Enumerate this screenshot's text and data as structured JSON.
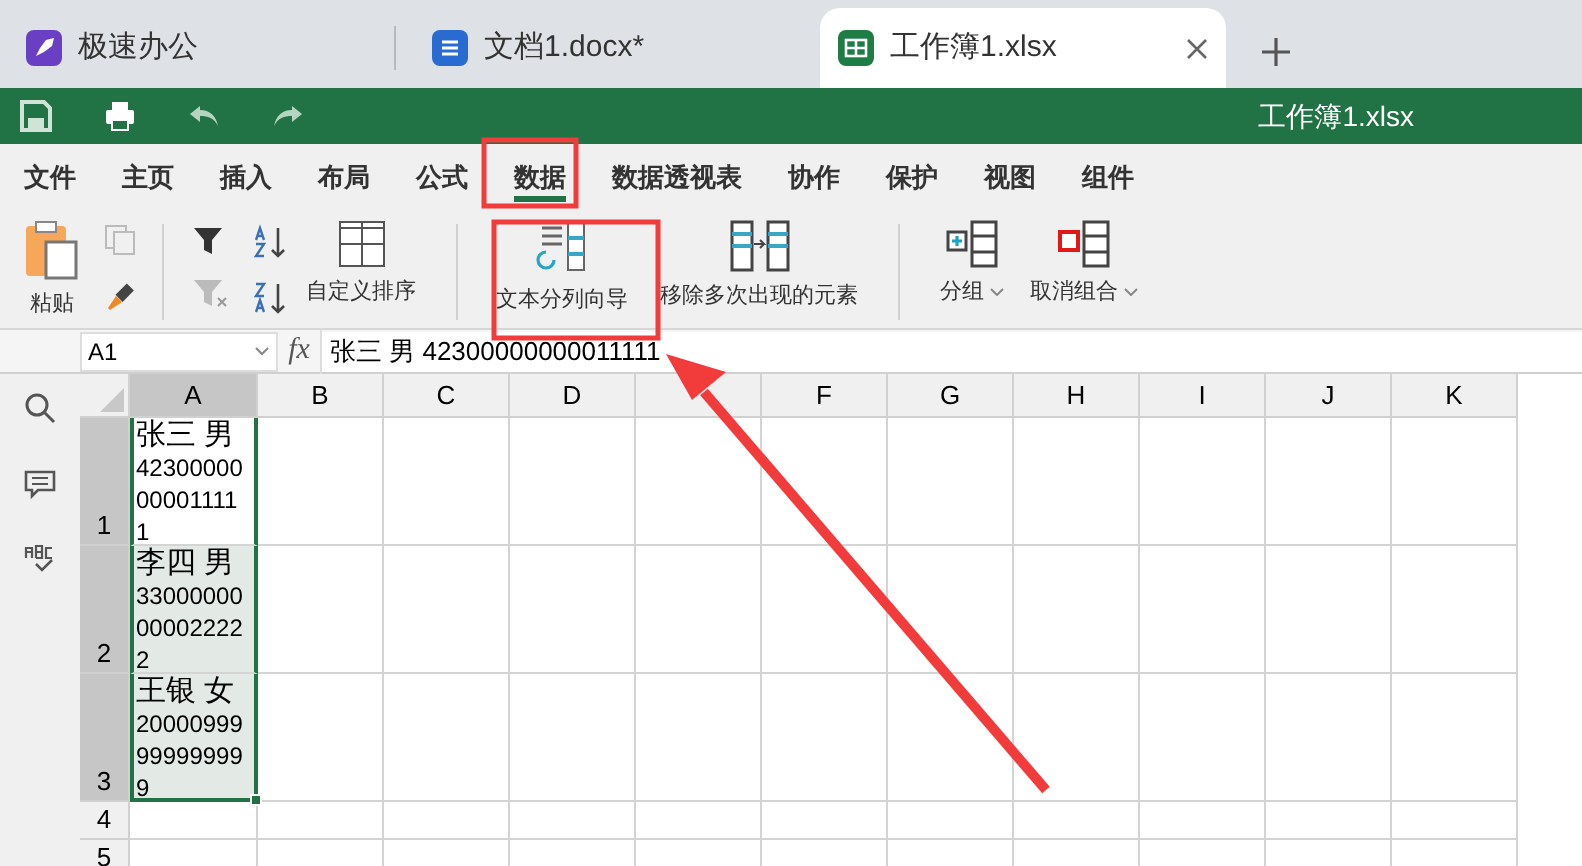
{
  "tabs": [
    {
      "label": "极速办公",
      "kind": "home",
      "selected": false
    },
    {
      "label": "文档1.docx*",
      "kind": "doc",
      "selected": false
    },
    {
      "label": "工作簿1.xlsx",
      "kind": "sheet",
      "selected": true
    }
  ],
  "window": {
    "title": "工作簿1.xlsx"
  },
  "menu": [
    {
      "label": "文件",
      "selected": false
    },
    {
      "label": "主页",
      "selected": false
    },
    {
      "label": "插入",
      "selected": false
    },
    {
      "label": "布局",
      "selected": false
    },
    {
      "label": "公式",
      "selected": false
    },
    {
      "label": "数据",
      "selected": true
    },
    {
      "label": "数据透视表",
      "selected": false
    },
    {
      "label": "协作",
      "selected": false
    },
    {
      "label": "保护",
      "selected": false
    },
    {
      "label": "视图",
      "selected": false
    },
    {
      "label": "组件",
      "selected": false
    }
  ],
  "ribbon": {
    "paste": {
      "label": "粘贴"
    },
    "custom_sort": {
      "label": "自定义排序"
    },
    "text_to_columns": {
      "label": "文本分列向导"
    },
    "remove_duplicates": {
      "label": "移除多次出现的元素"
    },
    "group": {
      "label": "分组"
    },
    "ungroup": {
      "label": "取消组合"
    }
  },
  "formula_bar": {
    "name_box": "A1",
    "fx": "fx",
    "value": "张三 男 42300000000011111"
  },
  "sheet": {
    "columns": [
      {
        "label": "A",
        "selected": true
      },
      {
        "label": "B",
        "selected": false
      },
      {
        "label": "C",
        "selected": false
      },
      {
        "label": "D",
        "selected": false
      },
      {
        "selected": false
      },
      {
        "label": "F",
        "selected": false
      },
      {
        "label": "G",
        "selected": false
      },
      {
        "label": "H",
        "selected": false
      },
      {
        "label": "I",
        "selected": false
      },
      {
        "label": "J",
        "selected": false
      },
      {
        "label": "K",
        "selected": false
      }
    ],
    "rows": [
      {
        "label": "1",
        "selected": true,
        "active": true,
        "lines": [
          "张三 男",
          "42300000",
          "00001111",
          "1"
        ]
      },
      {
        "label": "2",
        "selected": true,
        "active": false,
        "lines": [
          "李四 男",
          "33000000",
          "00002222",
          "2"
        ]
      },
      {
        "label": "3",
        "selected": true,
        "active": false,
        "lines": [
          "王银 女",
          "20000999",
          "99999999",
          "9"
        ]
      },
      {
        "label": "4",
        "selected": false
      },
      {
        "label": "5",
        "selected": false
      }
    ]
  }
}
